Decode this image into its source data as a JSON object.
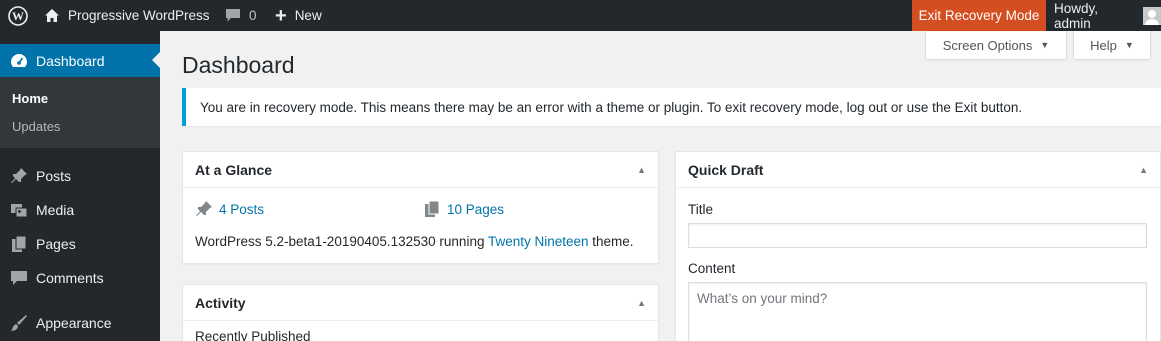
{
  "adminbar": {
    "site_name": "Progressive WordPress",
    "comments_count": "0",
    "new_label": "New",
    "recovery_label": "Exit Recovery Mode",
    "howdy": "Howdy, admin"
  },
  "sidebar": {
    "dashboard_label": "Dashboard",
    "submenu": [
      "Home",
      "Updates"
    ],
    "items": [
      {
        "label": "Posts",
        "icon": "pin-icon"
      },
      {
        "label": "Media",
        "icon": "media-icon"
      },
      {
        "label": "Pages",
        "icon": "pages-icon"
      },
      {
        "label": "Comments",
        "icon": "comment-icon"
      },
      {
        "label": "Appearance",
        "icon": "brush-icon"
      }
    ]
  },
  "screen_options_label": "Screen Options",
  "help_label": "Help",
  "page_title": "Dashboard",
  "notice_text": "You are in recovery mode. This means there may be an error with a theme or plugin. To exit recovery mode, log out or use the Exit button.",
  "glance": {
    "title": "At a Glance",
    "posts": "4 Posts",
    "pages": "10 Pages",
    "footer_prefix": "WordPress 5.2-beta1-20190405.132530 running ",
    "theme_link": "Twenty Nineteen",
    "footer_suffix": " theme."
  },
  "activity": {
    "title": "Activity",
    "recently": "Recently Published"
  },
  "draft": {
    "title": "Quick Draft",
    "title_label": "Title",
    "content_label": "Content",
    "content_placeholder": "What’s on your mind?"
  },
  "colors": {
    "adminbar_bg": "#23282d",
    "accent": "#0073aa",
    "recovery_bg": "#d54e21",
    "notice_border": "#00a0d2"
  }
}
